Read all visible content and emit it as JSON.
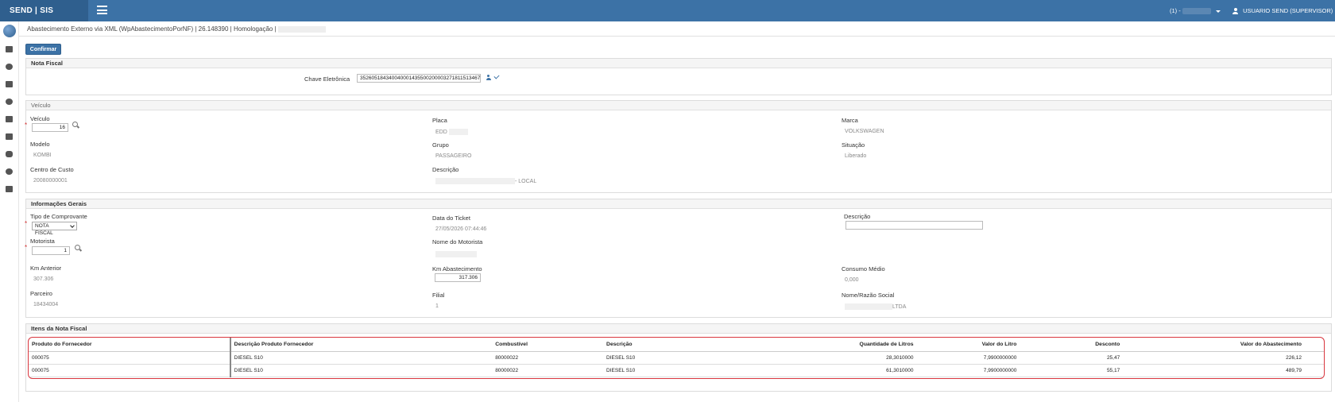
{
  "topbar": {
    "brand": "SEND | SIS",
    "company_prefix": "(1) -",
    "user": "USUARIO SEND (SUPERVISOR)"
  },
  "breadcrumb": {
    "text": "Abastecimento Externo via XML (WpAbastecimentoPorNF) | 26.148390 | Homologação |"
  },
  "toolbar": {
    "confirm_label": "Confirmar"
  },
  "nota_fiscal": {
    "title": "Nota Fiscal",
    "chave_label": "Chave Eletrônica",
    "chave_value": "35260518434004000143550020000327181151346750"
  },
  "veiculo": {
    "title": "Veículo",
    "veiculo_label": "Veículo",
    "veiculo_value": "16",
    "placa_label": "Placa",
    "placa_value": "EDD",
    "marca_label": "Marca",
    "marca_value": "VOLKSWAGEN",
    "modelo_label": "Modelo",
    "modelo_value": "KOMBI",
    "grupo_label": "Grupo",
    "grupo_value": "PASSAGEIRO",
    "situacao_label": "Situação",
    "situacao_value": "Liberado",
    "centro_label": "Centro de Custo",
    "centro_value": "20080000001",
    "descricao_label": "Descrição",
    "descricao_value": "- LOCAL"
  },
  "info": {
    "title": "Informações Gerais",
    "tipo_label": "Tipo de Comprovante",
    "tipo_value": "NOTA FISCAL",
    "data_label": "Data do Ticket",
    "data_value": "27/05/2026 07:44:46",
    "descricao_label": "Descrição",
    "descricao_value": "",
    "motorista_label": "Motorista",
    "motorista_value": "1",
    "nome_motorista_label": "Nome do Motorista",
    "km_anterior_label": "Km Anterior",
    "km_anterior_value": "307.306",
    "km_abast_label": "Km Abastecimento",
    "km_abast_value": "317.306",
    "consumo_label": "Consumo Médio",
    "consumo_value": "0,000",
    "parceiro_label": "Parceiro",
    "parceiro_value": "18434004",
    "filial_label": "Filial",
    "filial_value": "1",
    "razao_label": "Nome/Razão Social",
    "razao_value": "LTDA"
  },
  "itens": {
    "title": "Itens da Nota Fiscal",
    "columns": [
      "Produto do Fornecedor",
      "Descrição Produto Fornecedor",
      "Combustível",
      "Descrição",
      "Quantidade de Litros",
      "Valor do Litro",
      "Desconto",
      "Valor do Abastecimento"
    ],
    "rows": [
      [
        "000075",
        "DIESEL S10",
        "80000022",
        "DIESEL S10",
        "28,3010000",
        "7,9900000000",
        "25,47",
        "226,12"
      ],
      [
        "000075",
        "DIESEL S10",
        "80000022",
        "DIESEL S10",
        "61,3010000",
        "7,9900000000",
        "55,17",
        "489,79"
      ]
    ]
  }
}
